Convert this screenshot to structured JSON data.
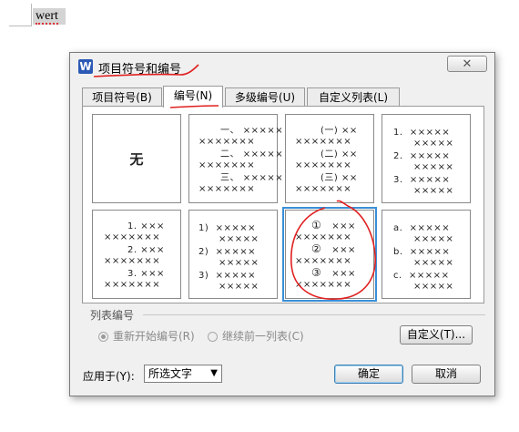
{
  "document": {
    "text": "wert"
  },
  "dialog": {
    "title": "项目符号和编号",
    "app_icon": "W",
    "close_glyph": "✕",
    "tabs": [
      {
        "label": "项目符号(B)"
      },
      {
        "label": "编号(N)"
      },
      {
        "label": "多级编号(U)"
      },
      {
        "label": "自定义列表(L)"
      }
    ],
    "active_tab": "编号(N)",
    "numbering_formats": {
      "none_label": "无",
      "chinese": [
        "一、",
        "二、",
        "三、"
      ],
      "paren_chinese": [
        "(一)",
        "(二)",
        "(三)"
      ],
      "decimal_dot": [
        "1.",
        "2.",
        "3."
      ],
      "decimal_dot_indented": [
        "1.",
        "2.",
        "3."
      ],
      "decimal_paren": [
        "1)",
        "2)",
        "3)"
      ],
      "circled": [
        "①",
        "②",
        "③"
      ],
      "alpha_dot": [
        "a.",
        "b.",
        "c."
      ],
      "placeholder": "×××××"
    },
    "list_numbering": {
      "group_label": "列表编号",
      "restart_label": "重新开始编号(R)",
      "continue_label": "继续前一列表(C)",
      "custom_button": "自定义(T)..."
    },
    "apply_to": {
      "label": "应用于(Y):",
      "selected": "所选文字"
    },
    "ok_button": "确定",
    "cancel_button": "取消"
  },
  "colors": {
    "annotation": "#e02020",
    "selection": "#3a8fd8",
    "icon": "#2b59b5"
  }
}
